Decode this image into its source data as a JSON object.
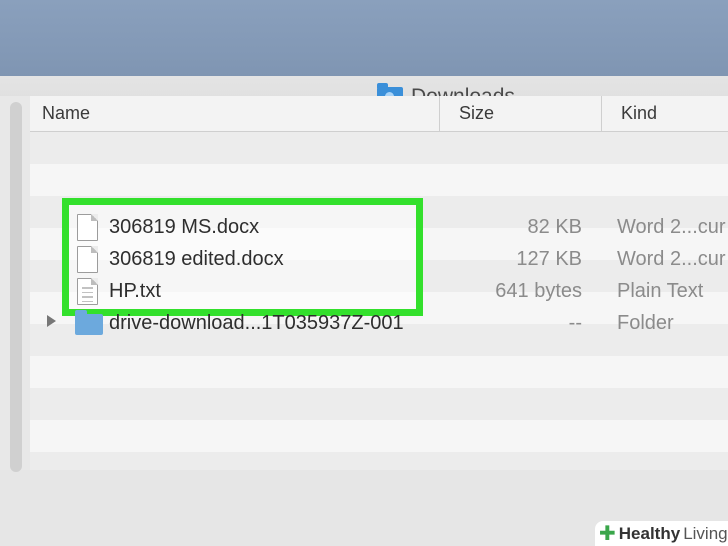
{
  "window": {
    "title": "Downloads"
  },
  "toolbar": {
    "view_buttons": [
      "icon-view-icon",
      "list-view-icon",
      "column-view-icon",
      "cover-flow-icon"
    ],
    "arrange_icon": "arrange-icon",
    "action_icon": "gear-icon",
    "share_icon": "share-icon",
    "tags_icon": "tag-icon"
  },
  "columns": {
    "name": "Name",
    "size": "Size",
    "kind": "Kind"
  },
  "files": [
    {
      "name": "306819 MS.docx",
      "size": "82 KB",
      "kind": "Word 2...cur",
      "icon": "document-icon",
      "highlighted": true
    },
    {
      "name": "306819 edited.docx",
      "size": "127 KB",
      "kind": "Word 2...cur",
      "icon": "document-icon",
      "highlighted": true
    },
    {
      "name": "HP.txt",
      "size": "641 bytes",
      "kind": "Plain Text",
      "icon": "text-file-icon",
      "highlighted": true
    },
    {
      "name": "drive-download...1T035937Z-001",
      "size": "--",
      "kind": "Folder",
      "icon": "folder-icon",
      "highlighted": false
    }
  ],
  "watermark": {
    "brand": "Healthy",
    "suffix": "Living"
  },
  "colors": {
    "highlight": "#33e02c",
    "folder": "#6ca9dd"
  }
}
